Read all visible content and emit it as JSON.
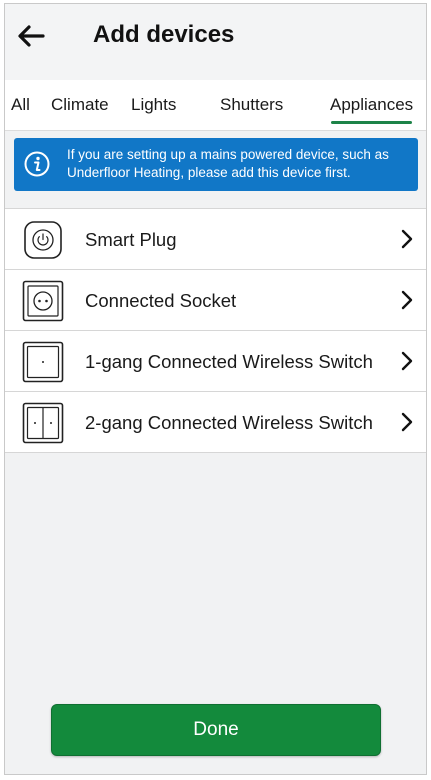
{
  "header": {
    "title": "Add devices",
    "back_icon": "arrow-left-icon"
  },
  "tabs": [
    {
      "label": "All",
      "active": false
    },
    {
      "label": "Climate",
      "active": false
    },
    {
      "label": "Lights",
      "active": false
    },
    {
      "label": "Shutters",
      "active": false
    },
    {
      "label": "Appliances",
      "active": true
    }
  ],
  "banner": {
    "icon": "info-icon",
    "text": "If you are setting up a mains powered device, such as Underfloor Heating, please add this device first."
  },
  "devices": [
    {
      "label": "Smart Plug",
      "icon": "smart-plug-icon"
    },
    {
      "label": "Connected Socket",
      "icon": "connected-socket-icon"
    },
    {
      "label": "1-gang Connected Wireless Switch",
      "icon": "one-gang-switch-icon"
    },
    {
      "label": "2-gang Connected Wireless Switch",
      "icon": "two-gang-switch-icon"
    }
  ],
  "footer": {
    "done_label": "Done"
  },
  "colors": {
    "accent_green": "#138a3c",
    "banner_blue": "#1177c7",
    "tab_underline": "#1d8348"
  }
}
